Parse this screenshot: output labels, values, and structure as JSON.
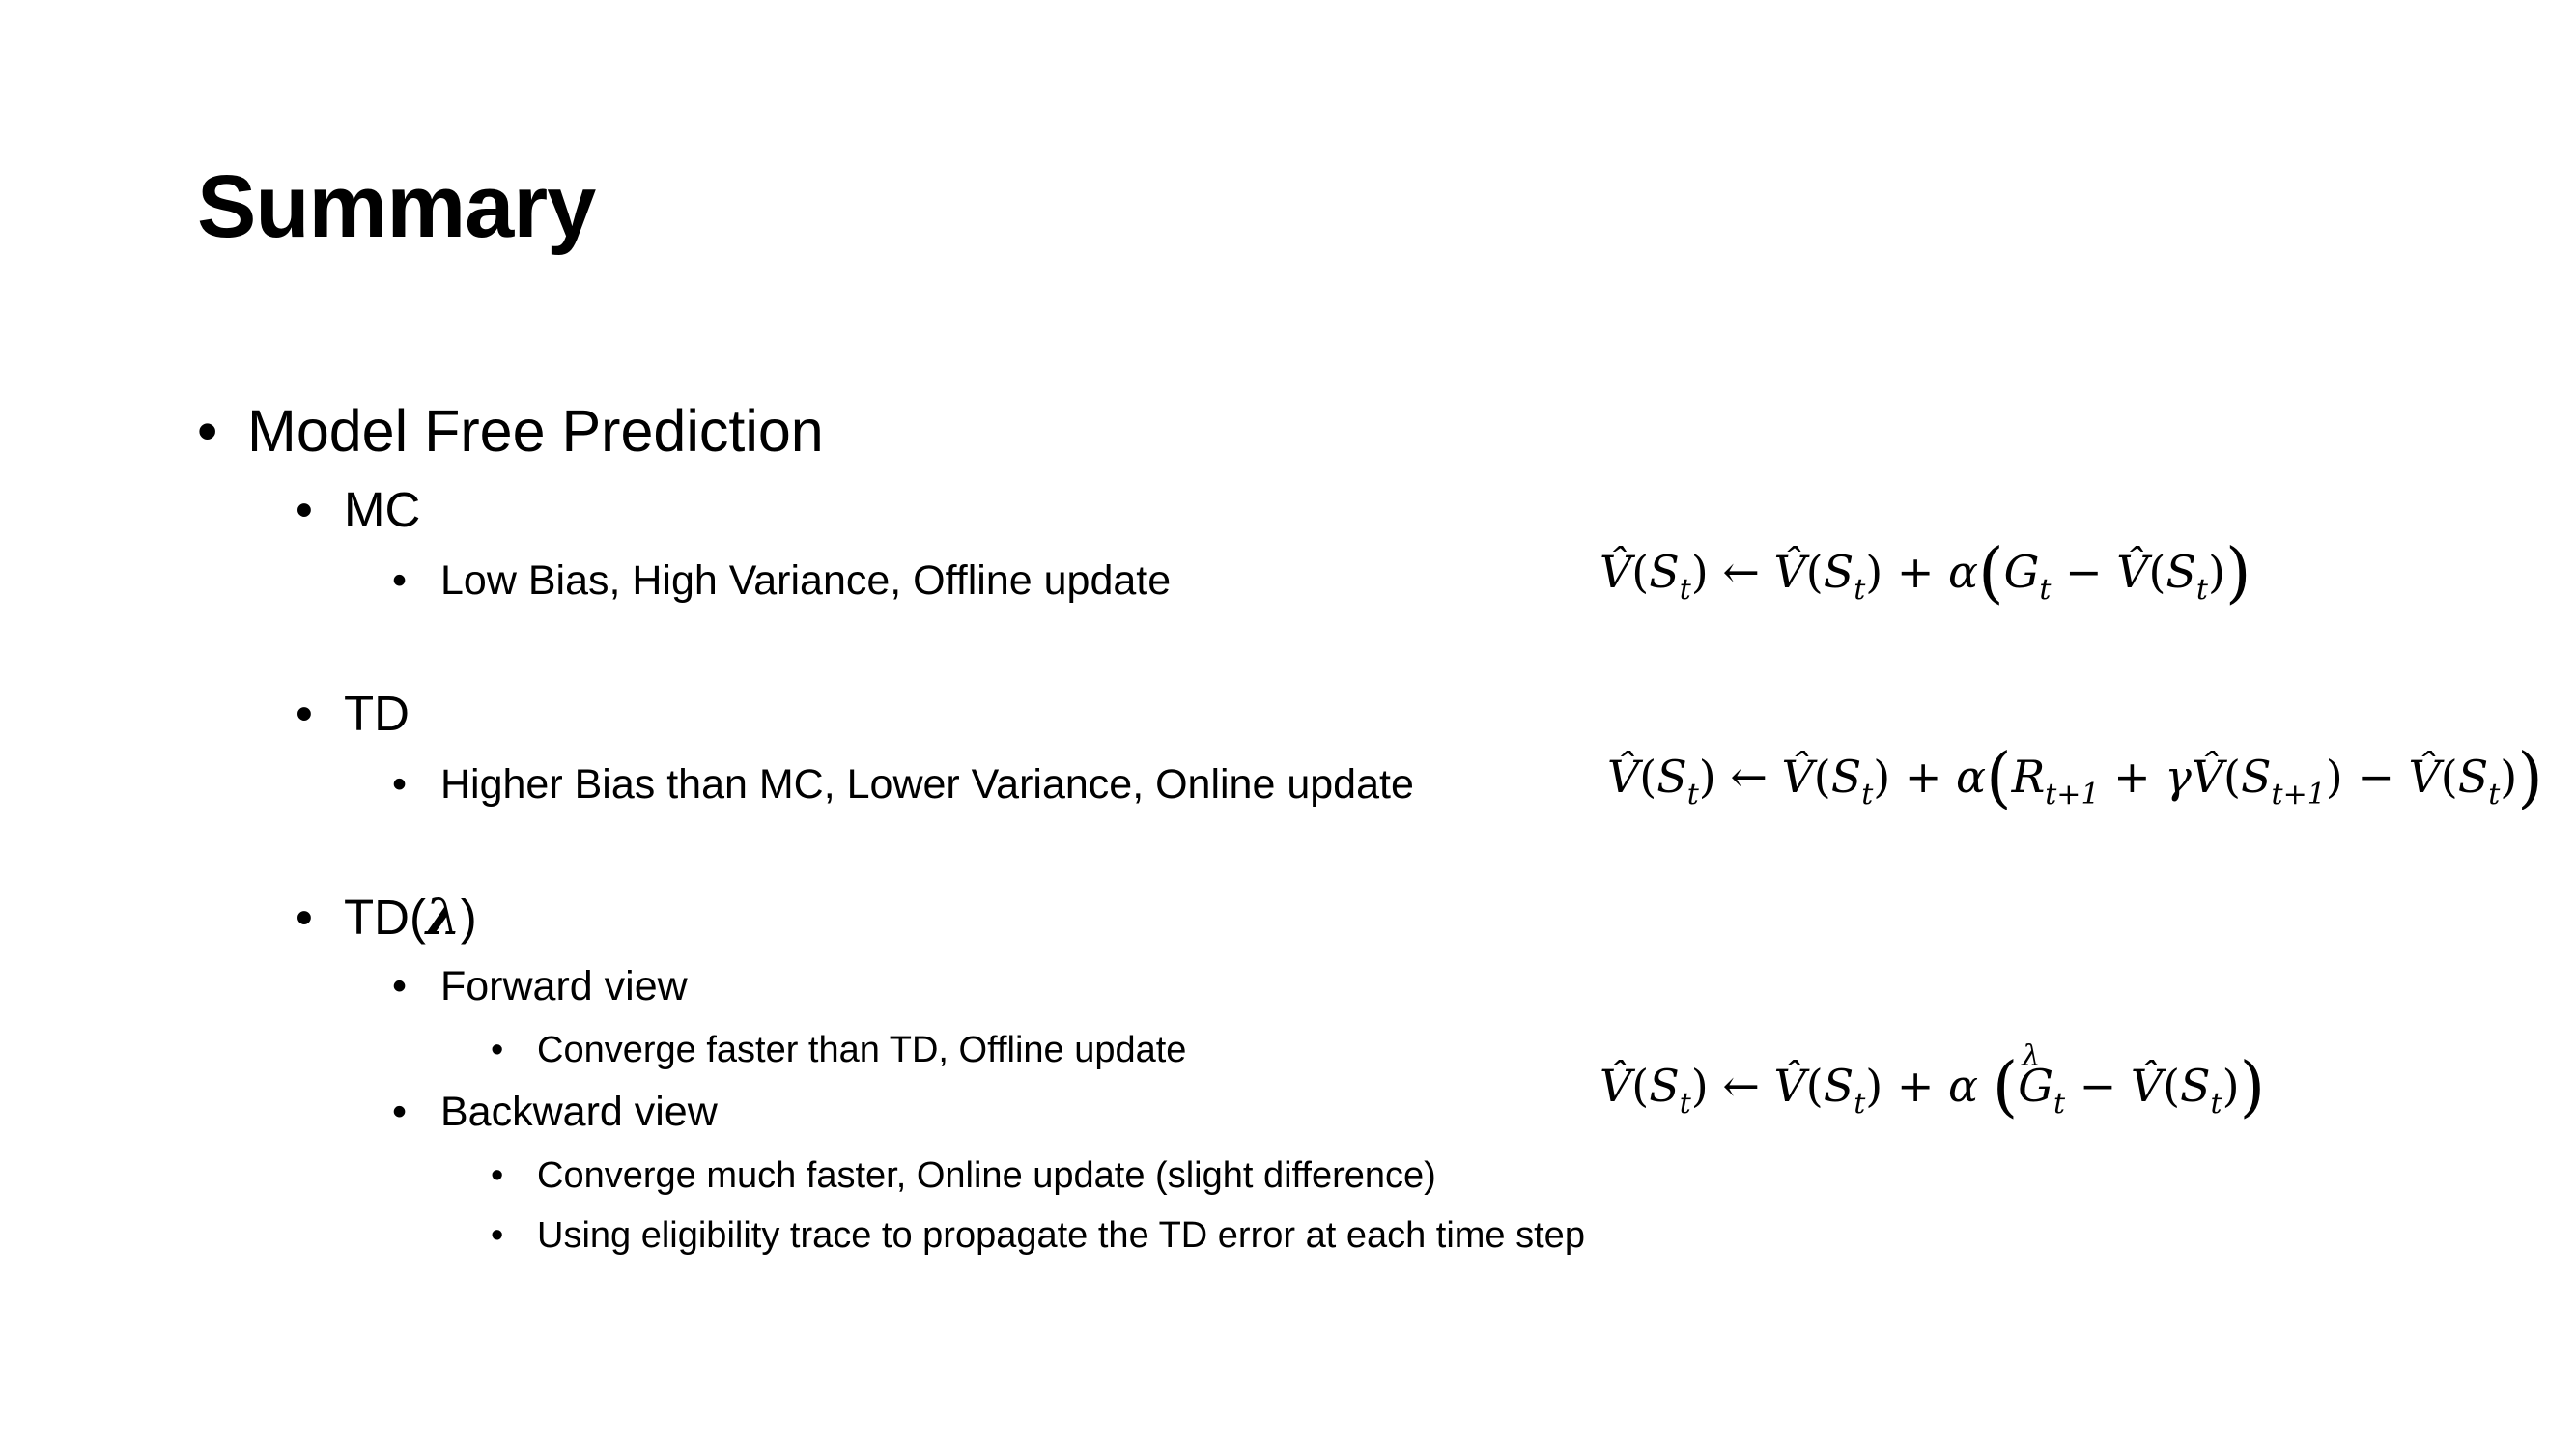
{
  "slide": {
    "title": "Summary"
  },
  "bullets": {
    "symbol": "•",
    "l1": {
      "label": "Model Free Prediction"
    },
    "mc": {
      "label": "MC",
      "detail": "Low Bias, High Variance, Offline update"
    },
    "td": {
      "label": "TD",
      "detail": "Higher Bias than MC, Lower Variance, Online update"
    },
    "tdl": {
      "label_prefix": "TD(",
      "label_symbol": "λ",
      "label_suffix": ")",
      "forward": {
        "label": "Forward view",
        "detail": "Converge faster than TD, Offline update"
      },
      "backward": {
        "label": "Backward view",
        "detail_1": "Converge much faster, Online update (slight difference)",
        "detail_2": "Using eligibility trace to propagate the TD error at each time step"
      }
    }
  },
  "formulas": {
    "mc": "V̂(S_t) ← V̂(S_t) + α(G_t − V̂(S_t))",
    "td": "V̂(S_t) ← V̂(S_t) + α(R_{t+1} + γV̂(S_{t+1}) − V̂(S_t))",
    "tdl": "V̂(S_t) ← V̂(S_t) + α(G_t^λ − V̂(S_t))"
  }
}
